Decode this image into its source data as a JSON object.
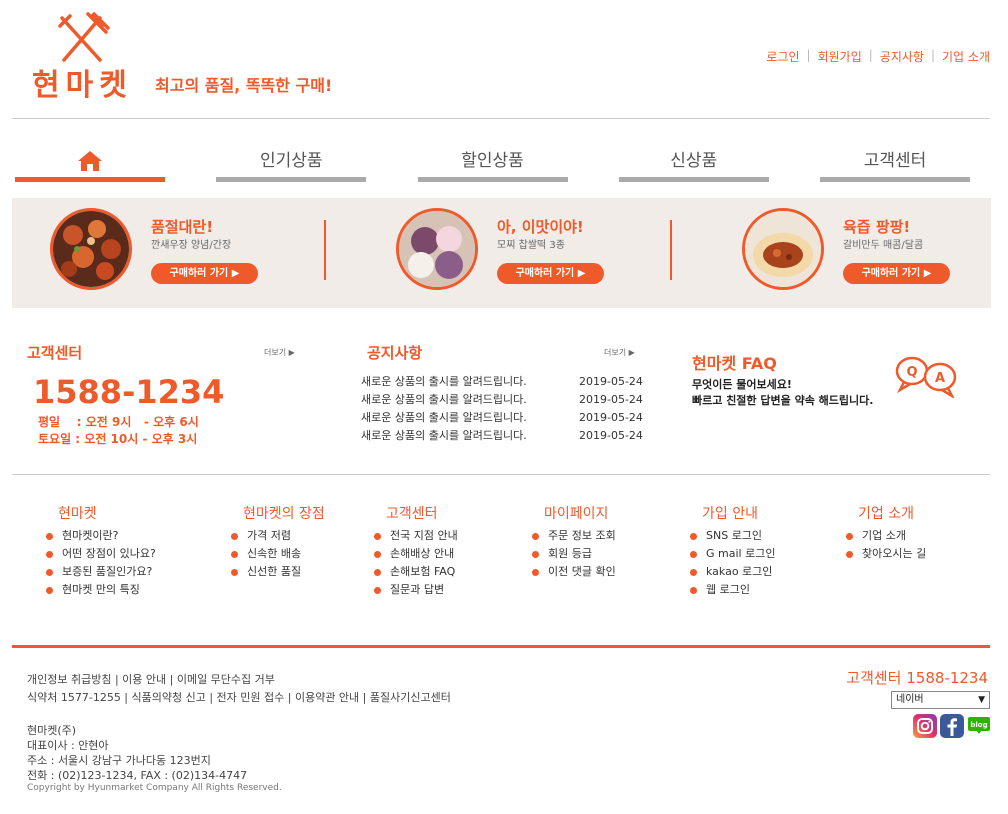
{
  "header": {
    "logo_text": "현마켓",
    "tagline": "최고의 품질, 똑똑한 구매!",
    "top_links": [
      "로그인",
      "회원가입",
      "공지사항",
      "기업 소개"
    ]
  },
  "nav": {
    "home_icon": "home-icon",
    "items": [
      "인기상품",
      "할인상품",
      "신상품",
      "고객센터"
    ]
  },
  "promos": [
    {
      "title": "품절대란!",
      "sub": "깐새우장 양념/간장",
      "button": "구매하러 가기 ▶"
    },
    {
      "title": "아, 이맛이야!",
      "sub": "모찌 찹쌀떡 3종",
      "button": "구매하러 가기 ▶"
    },
    {
      "title": "육즙 팡팡!",
      "sub": "갈비만두 매콤/달콤",
      "button": "구매하러 가기 ▶"
    }
  ],
  "customer_center": {
    "title": "고객센터",
    "more": "더보기 ▶",
    "phone": "1588-1234",
    "weekday": "평일    : 오전 9시   - 오후 6시",
    "saturday": "토요일 : 오전 10시 - 오후 3시"
  },
  "notice": {
    "title": "공지사항",
    "more": "더보기 ▶",
    "rows": [
      {
        "text": "새로운 상품의 출시를 알려드립니다.",
        "date": "2019-05-24"
      },
      {
        "text": "새로운 상품의 출시를 알려드립니다.",
        "date": "2019-05-24"
      },
      {
        "text": "새로운 상품의 출시를 알려드립니다.",
        "date": "2019-05-24"
      },
      {
        "text": "새로운 상품의 출시를 알려드립니다.",
        "date": "2019-05-24"
      }
    ]
  },
  "faq": {
    "title": "현마켓 FAQ",
    "line1": "무엇이든 물어보세요!",
    "line2": "빠르고 친절한 답변을 약속 해드립니다.",
    "icon": "qa-bubbles-icon"
  },
  "footer_columns": [
    {
      "title": "현마켓",
      "items": [
        "현마켓이란?",
        "어떤 장점이 있나요?",
        "보증된 품질인가요?",
        "현마켓 만의 특징"
      ]
    },
    {
      "title": "현마켓의 장점",
      "items": [
        "가격 저렴",
        "신속한 배송",
        "신선한 품질"
      ]
    },
    {
      "title": "고객센터",
      "items": [
        "전국 지점 안내",
        "손해배상 안내",
        "손해보험 FAQ",
        "질문과 답변"
      ]
    },
    {
      "title": "마이페이지",
      "items": [
        "주문 정보 조회",
        "회원 등급",
        "이전 댓글 확인"
      ]
    },
    {
      "title": "가입 안내",
      "items": [
        "SNS 로그인",
        "G mail 로그인",
        "kakao 로그인",
        "웹 로그인"
      ]
    },
    {
      "title": "기업 소개",
      "items": [
        "기업 소개",
        "찾아오시는 길"
      ]
    }
  ],
  "bottom": {
    "links1": "개인정보 취급방침 | 이용 안내 | 이메일 무단수집 거부",
    "links2": "식약처 1577-1255 | 식품의약청 신고 | 전자 민원 접수 | 이용약관 안내 | 품질사기신고센터",
    "company_name": "현마켓(주)",
    "ceo": "대표이사 : 안현아",
    "address": "주소 : 서울시 강남구 가나다동 123번지",
    "tel": "전화 : (02)123-1234, FAX : (02)134-4747",
    "copyright": "Copyright by Hyunmarket Company All Rights Reserved.",
    "cs_phone": "고객센터 1588-1234",
    "select_value": "네이버",
    "social": [
      "instagram-icon",
      "facebook-icon",
      "blog-icon"
    ]
  },
  "colors": {
    "accent": "#ef5a2b",
    "promo_bg": "#f2ece8",
    "nav_inactive": "#aaaaaa"
  }
}
